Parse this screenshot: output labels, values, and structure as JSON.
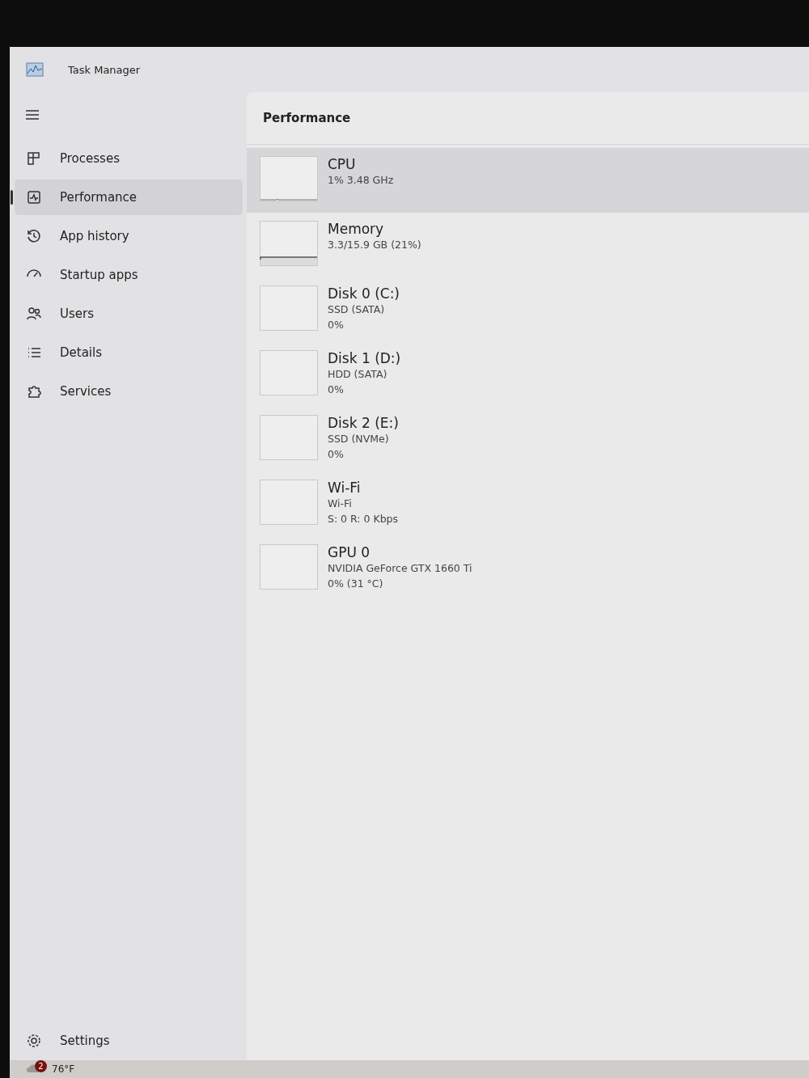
{
  "window": {
    "title": "Task Manager"
  },
  "nav": [
    {
      "label": "Processes",
      "kind": "processes",
      "selected": false
    },
    {
      "label": "Performance",
      "kind": "performance",
      "selected": true
    },
    {
      "label": "App history",
      "kind": "history",
      "selected": false
    },
    {
      "label": "Startup apps",
      "kind": "startup",
      "selected": false
    },
    {
      "label": "Users",
      "kind": "users",
      "selected": false
    },
    {
      "label": "Details",
      "kind": "details",
      "selected": false
    },
    {
      "label": "Services",
      "kind": "services",
      "selected": false
    }
  ],
  "settings": {
    "label": "Settings"
  },
  "page": {
    "title": "Performance"
  },
  "devices": [
    {
      "name": "CPU",
      "lines": [
        "1% 3.48 GHz"
      ],
      "selected": true,
      "kind": "cpu"
    },
    {
      "name": "Memory",
      "lines": [
        "3.3/15.9 GB (21%)"
      ],
      "selected": false,
      "kind": "memory"
    },
    {
      "name": "Disk 0 (C:)",
      "lines": [
        "SSD (SATA)",
        "0%"
      ],
      "selected": false,
      "kind": "flat"
    },
    {
      "name": "Disk 1 (D:)",
      "lines": [
        "HDD (SATA)",
        "0%"
      ],
      "selected": false,
      "kind": "flat"
    },
    {
      "name": "Disk 2 (E:)",
      "lines": [
        "SSD (NVMe)",
        "0%"
      ],
      "selected": false,
      "kind": "flat"
    },
    {
      "name": "Wi-Fi",
      "lines": [
        "Wi-Fi",
        "S: 0 R: 0 Kbps"
      ],
      "selected": false,
      "kind": "flat"
    },
    {
      "name": "GPU 0",
      "lines": [
        "NVIDIA GeForce GTX 1660 Ti",
        "0% (31 °C)"
      ],
      "selected": false,
      "kind": "flat"
    }
  ],
  "taskbar": {
    "weather": "76°F",
    "badge": "2"
  }
}
